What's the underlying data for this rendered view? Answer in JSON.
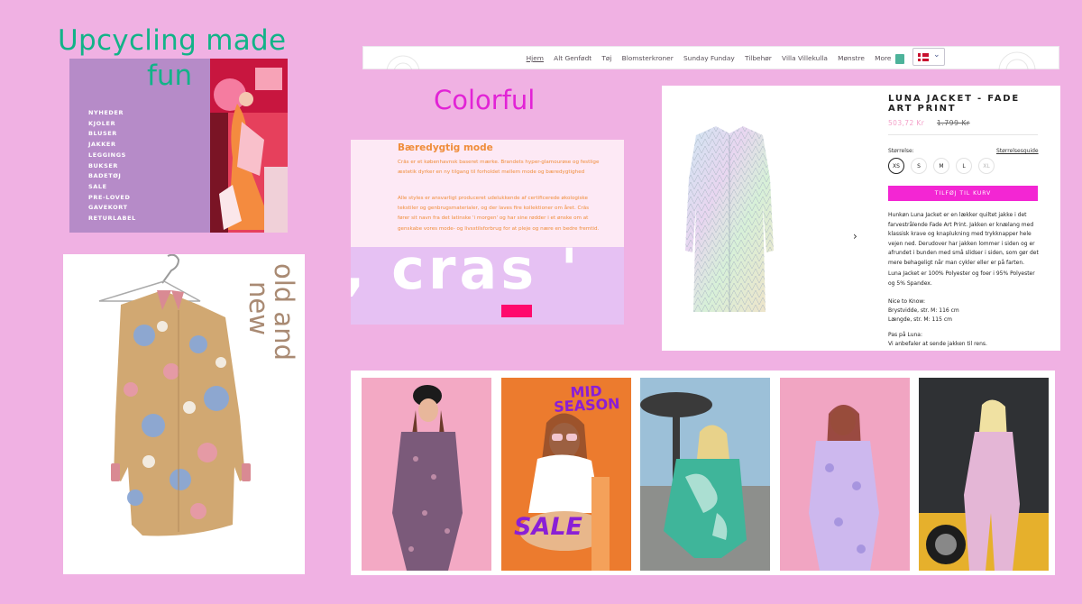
{
  "board": {
    "upcycling_title": "Upcycling made",
    "upcycling_title2": "fun",
    "colorful_title": "Colorful",
    "oldnew_title_1": "old and",
    "oldnew_title_2": "new"
  },
  "menu": {
    "items": [
      "NYHEDER",
      "KJOLER",
      "BLUSER",
      "JAKKER",
      "LEGGINGS",
      "BUKSER",
      "BADETØJ",
      "SALE",
      "PRE-LOVED",
      "GAVEKORT",
      "RETURLABEL"
    ]
  },
  "info": {
    "heading": "Bæredygtig mode",
    "para1": "Crās er et københavnsk baseret mærke. Brandets hyper-glamourøse og festlige æstetik dyrker en ny tilgang til forholdet mellem mode og bæredygtighed",
    "para2": "Alle styles er ansvarligt produceret udelukkende af certificerede økologiske tekstiler og genbrugsmaterialer, og der laves fire kollektioner om året. Crās fører sit navn fra det latinske 'i morgen' og har sine rødder i et ønske om at genskabe vores mode- og livsstilsforbrug for at pleje og nære en bedre fremtid.",
    "brand_text": "cras"
  },
  "nav": {
    "items": [
      "Hjem",
      "Alt Genfødt",
      "Tøj",
      "Blomsterkroner",
      "Sunday Funday",
      "Tilbehør",
      "Villa Villekulla",
      "Mønstre",
      "More"
    ]
  },
  "product": {
    "title": "LUNA JACKET - FADE ART PRINT",
    "price": "503,72 Kr",
    "old_price": "1.799 Kr",
    "size_label": "Størrelse:",
    "size_guide": "Størrelsesguide",
    "sizes": [
      "XS",
      "S",
      "M",
      "L",
      "XL"
    ],
    "cart_button": "TILFØJ TIL KURV",
    "desc1": "Hunkøn Luna Jacket er en lækker quiltet jakke i det farvestrålende Fade Art Print. Jakken er knælang med klassisk krave og knaplukning med trykknapper hele vejen ned. Derudover har jakken lommer i siden og er afrundet i bunden med små slidser i siden, som gør det mere behageligt når man cykler eller er på farten.",
    "desc2": "Luna Jacket er 100% Polyester og foer i 95% Polyester og 5% Spandex.",
    "desc3_title": "Nice to Know:",
    "desc3_l1": "Brystvidde, str. M: 116 cm",
    "desc3_l2": "Længde, str. M: 115 cm",
    "desc4_title": "Pas på Luna:",
    "desc4_l1": "Vi anbefaler at sende jakken til rens."
  },
  "strip": {
    "overlay_top": "MID SEASON",
    "overlay_bottom": "SALE"
  },
  "colors": {
    "background": "#f0b1e3",
    "green_title": "#12b388",
    "pink_title": "#e223d6",
    "menu_panel": "#b68bc8",
    "cart_button": "#f326d3",
    "red_button": "#ff0a6c"
  }
}
